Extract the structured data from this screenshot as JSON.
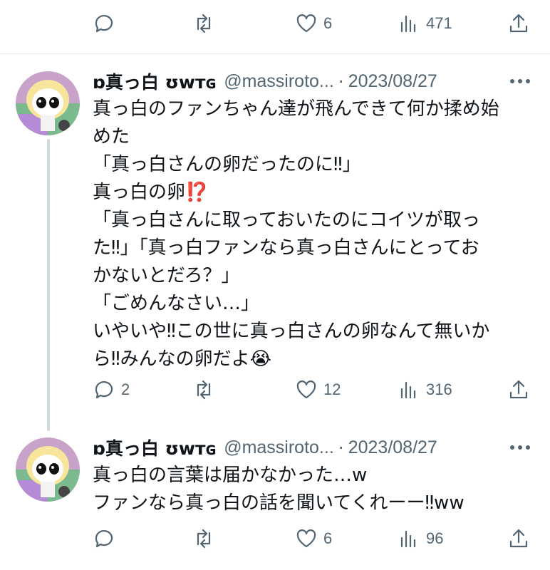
{
  "top_actions": {
    "reply": "",
    "retweet": "",
    "like": "6",
    "views": "471"
  },
  "tweets": [
    {
      "name": "ɒ真っ白 ʊᴡᴛɢ",
      "handle": "@massiroto...",
      "dot": "·",
      "date": "2023/08/27",
      "lines": [
        "真っ白のファンちゃん達が飛んできて何か揉め始",
        "めた",
        "「真っ白さんの卵だったのに‼」",
        "真っ白の卵⁉️",
        "「真っ白さんに取っておいたのにコイツが取っ",
        "た‼」「真っ白ファンなら真っ白さんにとってお",
        "かないとだろ？」",
        "「ごめんなさい…」",
        "いやいや‼この世に真っ白さんの卵なんて無いか",
        "ら‼みんなの卵だよ😭"
      ],
      "actions": {
        "reply": "2",
        "retweet": "",
        "like": "12",
        "views": "316"
      }
    },
    {
      "name": "ɒ真っ白 ʊᴡᴛɢ",
      "handle": "@massiroto...",
      "dot": "·",
      "date": "2023/08/27",
      "lines": [
        "真っ白の言葉は届かなかった…w",
        "ファンなら真っ白の話を聞いてくれーー‼ww"
      ],
      "actions": {
        "reply": "",
        "retweet": "",
        "like": "6",
        "views": "96"
      }
    }
  ],
  "icons": {
    "reply": "reply-icon",
    "retweet": "retweet-icon",
    "like": "heart-icon",
    "views": "views-icon",
    "share": "share-icon",
    "more": "more-icon"
  },
  "colors": {
    "text": "#0f1419",
    "muted": "#536471",
    "divider": "#e7e9ea",
    "thread": "#cfd9de"
  }
}
